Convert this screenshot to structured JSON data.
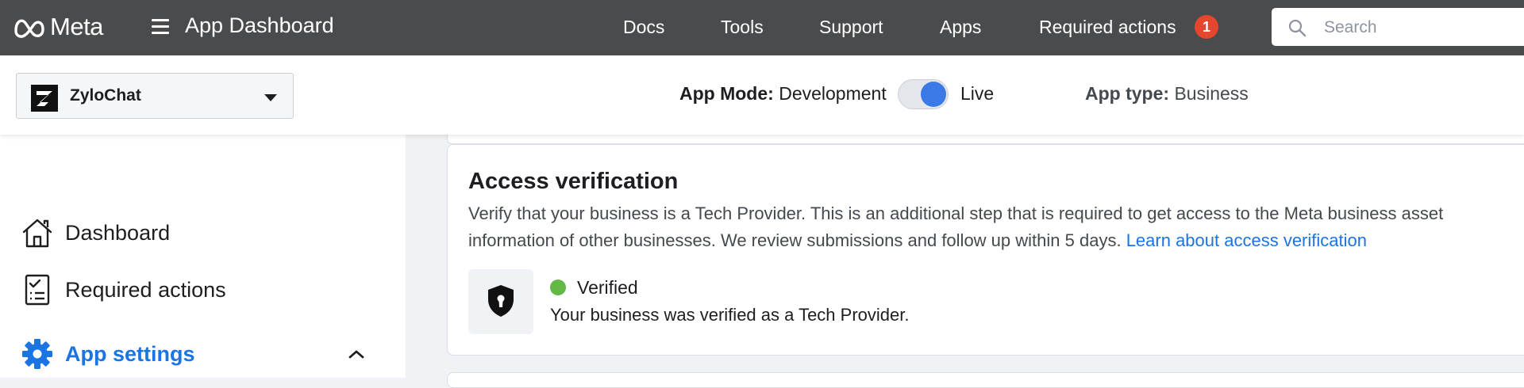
{
  "header": {
    "brand": "Meta",
    "app_title": "App Dashboard",
    "nav": [
      {
        "label": "Docs"
      },
      {
        "label": "Tools"
      },
      {
        "label": "Support"
      },
      {
        "label": "Apps"
      },
      {
        "label": "Required actions"
      }
    ],
    "required_actions_count": "1",
    "search_placeholder": "Search"
  },
  "subheader": {
    "app_name": "ZyloChat",
    "app_mode_label": "App Mode:",
    "app_mode_off": "Development",
    "app_mode_on": "Live",
    "app_mode_is_live": true,
    "app_type_label": "App type:",
    "app_type_value": "Business"
  },
  "sidebar": {
    "items": [
      {
        "label": "Dashboard",
        "icon": "home-icon"
      },
      {
        "label": "Required actions",
        "icon": "checklist-icon"
      },
      {
        "label": "App settings",
        "icon": "gear-icon",
        "active": true,
        "expanded": true
      }
    ]
  },
  "access_verification": {
    "title": "Access verification",
    "description_line1": "Verify that your business is a Tech Provider. This is an additional step that is required to get access to the Meta business asset",
    "description_line2": "information of other businesses. We review submissions and follow up within 5 days.",
    "learn_link": "Learn about access verification",
    "status": "Verified",
    "status_color": "#63b943",
    "status_detail": "Your business was verified as a Tech Provider."
  },
  "colors": {
    "topbar": "#4a4b4c",
    "accent": "#1b74e4",
    "toggle_knob": "#3b7ae6",
    "badge": "#e4462e"
  }
}
